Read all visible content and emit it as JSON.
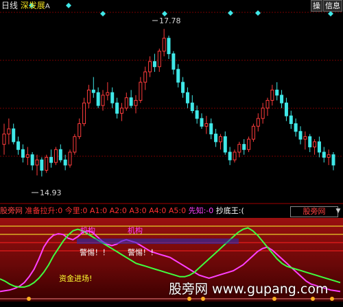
{
  "header": {
    "period": "日线",
    "name": "深发展",
    "code": "A",
    "buttons": [
      "操",
      "信息"
    ]
  },
  "price_labels": {
    "high": "17.78",
    "low": "14.93"
  },
  "indicator_bar": {
    "name": "股旁网",
    "items": [
      {
        "label": "准备拉升:",
        "value": "0",
        "color": "#ff3030"
      },
      {
        "label": "今里:",
        "value": "0",
        "color": "#ff3030"
      },
      {
        "label": "A1:",
        "value": "0",
        "color": "#ff3030"
      },
      {
        "label": "A2:",
        "value": "0",
        "color": "#ff3030"
      },
      {
        "label": "A3:",
        "value": "0",
        "color": "#ff3030"
      },
      {
        "label": "A4:",
        "value": "0",
        "color": "#ff3030"
      },
      {
        "label": "A5:",
        "value": "0",
        "color": "#ff3030"
      },
      {
        "label": "先知:",
        "value": "-0",
        "color": "#ff40ff"
      },
      {
        "label": "抄底王:",
        "value": "(",
        "color": "#ffffff"
      }
    ],
    "selector": "股旁网"
  },
  "annotations": {
    "top_left": "机构",
    "top_mid": "机构",
    "warn1": "警惕！！",
    "warn2": "警惕！！",
    "safe": "资金进场!"
  },
  "watermark": "股旁网 www.gupang.com",
  "colors": {
    "up": "#ff3c3c",
    "down": "#40e8e8",
    "grid": "#7a0000",
    "line1": "#ff40ff",
    "line2": "#40ff40",
    "yellow": "#ffff30"
  },
  "chart_data": [
    {
      "type": "candlestick",
      "high_label": 17.78,
      "low_label": 14.93,
      "ohlc": [
        [
          15.55,
          15.95,
          15.35,
          15.75
        ],
        [
          15.75,
          16.05,
          15.55,
          15.85
        ],
        [
          15.85,
          15.95,
          15.55,
          15.6
        ],
        [
          15.6,
          15.7,
          15.35,
          15.45
        ],
        [
          15.45,
          15.55,
          15.2,
          15.3
        ],
        [
          15.3,
          15.5,
          15.15,
          15.35
        ],
        [
          15.35,
          15.4,
          15.05,
          15.15
        ],
        [
          15.15,
          15.35,
          14.95,
          15.25
        ],
        [
          15.25,
          15.3,
          14.93,
          15.05
        ],
        [
          15.05,
          15.35,
          15.0,
          15.3
        ],
        [
          15.3,
          15.45,
          15.1,
          15.2
        ],
        [
          15.2,
          15.5,
          15.15,
          15.45
        ],
        [
          15.45,
          15.55,
          15.2,
          15.25
        ],
        [
          15.25,
          15.35,
          15.05,
          15.15
        ],
        [
          15.15,
          15.45,
          15.1,
          15.4
        ],
        [
          15.4,
          15.75,
          15.35,
          15.7
        ],
        [
          15.7,
          16.05,
          15.65,
          15.95
        ],
        [
          15.95,
          16.45,
          15.9,
          16.35
        ],
        [
          16.35,
          16.7,
          16.25,
          16.6
        ],
        [
          16.6,
          16.85,
          16.45,
          16.55
        ],
        [
          16.55,
          16.65,
          16.25,
          16.3
        ],
        [
          16.3,
          16.6,
          16.2,
          16.5
        ],
        [
          16.5,
          16.75,
          16.4,
          16.55
        ],
        [
          16.55,
          16.65,
          16.25,
          16.35
        ],
        [
          16.35,
          16.45,
          16.05,
          16.15
        ],
        [
          16.15,
          16.35,
          16.0,
          16.25
        ],
        [
          16.25,
          16.55,
          16.2,
          16.45
        ],
        [
          16.45,
          16.6,
          16.25,
          16.3
        ],
        [
          16.3,
          16.5,
          16.15,
          16.4
        ],
        [
          16.4,
          16.85,
          16.35,
          16.75
        ],
        [
          16.75,
          17.05,
          16.6,
          16.95
        ],
        [
          16.95,
          17.25,
          16.85,
          17.15
        ],
        [
          17.15,
          17.3,
          16.95,
          17.05
        ],
        [
          17.05,
          17.4,
          16.95,
          17.35
        ],
        [
          17.35,
          17.78,
          17.25,
          17.6
        ],
        [
          17.6,
          17.65,
          17.2,
          17.3
        ],
        [
          17.3,
          17.35,
          16.9,
          17.0
        ],
        [
          17.0,
          17.1,
          16.65,
          16.75
        ],
        [
          16.75,
          16.85,
          16.45,
          16.55
        ],
        [
          16.55,
          16.65,
          16.25,
          16.35
        ],
        [
          16.35,
          16.5,
          16.15,
          16.2
        ],
        [
          16.2,
          16.3,
          15.95,
          16.05
        ],
        [
          16.05,
          16.15,
          15.85,
          15.9
        ],
        [
          15.9,
          16.1,
          15.75,
          15.95
        ],
        [
          15.95,
          16.05,
          15.65,
          15.75
        ],
        [
          15.75,
          15.85,
          15.5,
          15.6
        ],
        [
          15.6,
          15.75,
          15.45,
          15.7
        ],
        [
          15.7,
          15.8,
          15.35,
          15.4
        ],
        [
          15.4,
          15.5,
          15.15,
          15.25
        ],
        [
          15.25,
          15.45,
          15.2,
          15.4
        ],
        [
          15.4,
          15.6,
          15.3,
          15.55
        ],
        [
          15.55,
          15.65,
          15.35,
          15.45
        ],
        [
          15.45,
          15.7,
          15.4,
          15.65
        ],
        [
          15.65,
          15.95,
          15.6,
          15.9
        ],
        [
          15.9,
          16.15,
          15.8,
          16.05
        ],
        [
          16.05,
          16.35,
          15.95,
          16.25
        ],
        [
          16.25,
          16.45,
          16.1,
          16.4
        ],
        [
          16.4,
          16.7,
          16.3,
          16.6
        ],
        [
          16.6,
          16.75,
          16.4,
          16.5
        ],
        [
          16.5,
          16.6,
          16.25,
          16.35
        ],
        [
          16.35,
          16.45,
          16.0,
          16.1
        ],
        [
          16.1,
          16.2,
          15.85,
          15.95
        ],
        [
          15.95,
          16.05,
          15.7,
          15.8
        ],
        [
          15.8,
          15.9,
          15.55,
          15.65
        ],
        [
          15.65,
          15.8,
          15.45,
          15.7
        ],
        [
          15.7,
          15.75,
          15.4,
          15.5
        ],
        [
          15.5,
          15.65,
          15.35,
          15.6
        ],
        [
          15.6,
          15.7,
          15.3,
          15.4
        ],
        [
          15.4,
          15.5,
          15.2,
          15.3
        ],
        [
          15.3,
          15.45,
          15.15,
          15.35
        ],
        [
          15.35,
          15.4,
          15.05,
          15.15
        ]
      ]
    },
    {
      "type": "line",
      "ylim": [
        0,
        100
      ],
      "series": [
        {
          "color": "#ff40ff",
          "values": [
            8,
            9,
            10,
            12,
            15,
            20,
            28,
            38,
            52,
            68,
            78,
            84,
            86,
            85,
            80,
            78,
            82,
            88,
            90,
            88,
            82,
            76,
            72,
            70,
            72,
            76,
            78,
            76,
            74,
            70,
            66,
            62,
            60,
            58,
            56,
            54,
            50,
            46,
            42,
            38,
            34,
            30,
            28,
            26,
            28,
            30,
            32,
            34,
            36,
            40,
            44,
            50,
            56,
            62,
            66,
            68,
            64,
            58,
            52,
            46,
            40,
            34,
            28,
            22,
            18,
            16,
            14,
            12,
            10,
            9,
            8
          ]
        },
        {
          "color": "#40ff40",
          "values": [
            25,
            22,
            18,
            15,
            14,
            14,
            16,
            20,
            26,
            34,
            44,
            56,
            66,
            76,
            84,
            90,
            92,
            90,
            86,
            82,
            78,
            74,
            70,
            66,
            62,
            58,
            54,
            50,
            46,
            44,
            42,
            40,
            38,
            36,
            34,
            32,
            30,
            28,
            28,
            30,
            34,
            40,
            46,
            52,
            58,
            64,
            70,
            76,
            82,
            88,
            92,
            94,
            90,
            84,
            76,
            68,
            60,
            52,
            46,
            42,
            40,
            38,
            36,
            34,
            32,
            30,
            28,
            26,
            24,
            22,
            20
          ]
        }
      ]
    }
  ]
}
